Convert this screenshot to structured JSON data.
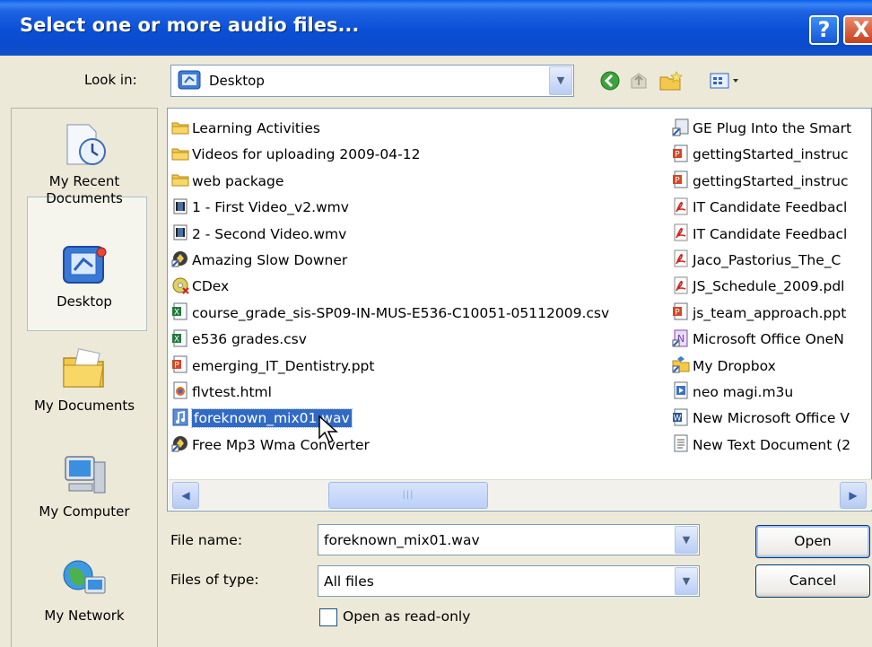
{
  "window": {
    "title": "Select one or more audio files...",
    "help_glyph": "?",
    "close_glyph": "X"
  },
  "lookin": {
    "label": "Look in:",
    "value": "Desktop"
  },
  "places": [
    {
      "label": "My Recent Documents",
      "icon": "recent-documents-icon"
    },
    {
      "label": "Desktop",
      "icon": "desktop-icon"
    },
    {
      "label": "My Documents",
      "icon": "my-documents-icon"
    },
    {
      "label": "My Computer",
      "icon": "my-computer-icon"
    },
    {
      "label": "My Network",
      "icon": "my-network-icon"
    }
  ],
  "files_col1": [
    {
      "name": "Learning Activities",
      "icon": "folder"
    },
    {
      "name": "Videos for uploading 2009-04-12",
      "icon": "folder"
    },
    {
      "name": "web package",
      "icon": "folder"
    },
    {
      "name": "1 - First Video_v2.wmv",
      "icon": "video"
    },
    {
      "name": "2 - Second Video.wmv",
      "icon": "video"
    },
    {
      "name": "Amazing Slow Downer",
      "icon": "app"
    },
    {
      "name": "CDex",
      "icon": "cd"
    },
    {
      "name": "course_grade_sis-SP09-IN-MUS-E536-C10051-05112009.csv",
      "icon": "excel"
    },
    {
      "name": "e536 grades.csv",
      "icon": "excel"
    },
    {
      "name": "emerging_IT_Dentistry.ppt",
      "icon": "powerpoint"
    },
    {
      "name": "flvtest.html",
      "icon": "html"
    },
    {
      "name": "foreknown_mix01.wav",
      "icon": "audio",
      "selected": true
    },
    {
      "name": "Free Mp3 Wma Converter",
      "icon": "app"
    }
  ],
  "files_col2": [
    {
      "name": "GE Plug Into the Smart",
      "icon": "shortcut"
    },
    {
      "name": "gettingStarted_instruc",
      "icon": "powerpoint"
    },
    {
      "name": "gettingStarted_instruc",
      "icon": "powerpoint"
    },
    {
      "name": "IT Candidate Feedbacl",
      "icon": "pdf"
    },
    {
      "name": "IT Candidate Feedbacl",
      "icon": "pdf"
    },
    {
      "name": "Jaco_Pastorius_The_C",
      "icon": "pdf"
    },
    {
      "name": "JS_Schedule_2009.pdl",
      "icon": "pdf"
    },
    {
      "name": "js_team_approach.ppt",
      "icon": "powerpoint"
    },
    {
      "name": "Microsoft Office OneN",
      "icon": "onenote"
    },
    {
      "name": "My Dropbox",
      "icon": "dropbox"
    },
    {
      "name": "neo magi.m3u",
      "icon": "playlist"
    },
    {
      "name": "New Microsoft Office V",
      "icon": "word"
    },
    {
      "name": "New Text Document (2",
      "icon": "text"
    }
  ],
  "scroll": {
    "left_glyph": "◀",
    "right_glyph": "▶",
    "thumb_grip": "|||"
  },
  "filename": {
    "label": "File name:",
    "value": "foreknown_mix01.wav"
  },
  "filetype": {
    "label": "Files of type:",
    "value": "All files"
  },
  "buttons": {
    "open": "Open",
    "cancel": "Cancel"
  },
  "readonly": {
    "label": "Open as read-only",
    "checked": false
  },
  "colors": {
    "titlebar": "#0A4FD6",
    "selection": "#316AC5",
    "dialog_bg": "#ECE9D8"
  }
}
